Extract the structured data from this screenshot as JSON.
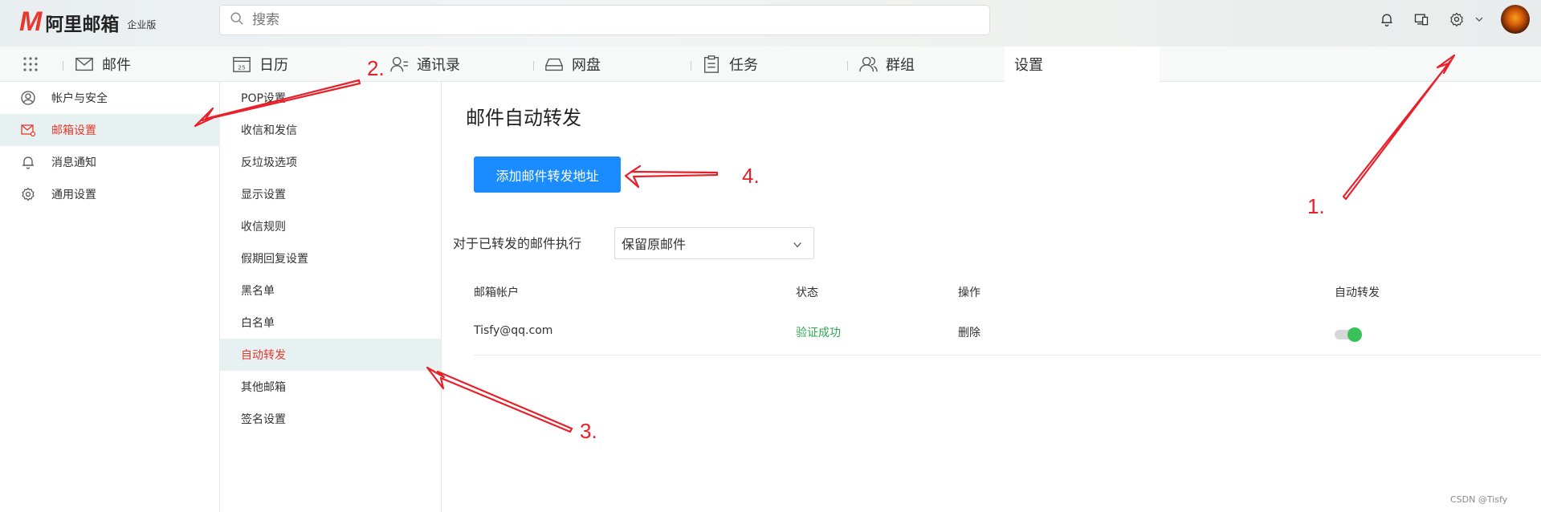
{
  "brand": {
    "mark": "M",
    "name": "阿里邮箱",
    "edition": "企业版",
    "accent": "#e8372c"
  },
  "search": {
    "placeholder": "搜索"
  },
  "header_icons": [
    "bell-icon",
    "devices-icon",
    "gear-icon",
    "chevron-down-icon"
  ],
  "nav": {
    "tabs": [
      {
        "label": "邮件",
        "icon": "mail-icon"
      },
      {
        "label": "日历",
        "icon": "calendar-icon",
        "badge": "25"
      },
      {
        "label": "通讯录",
        "icon": "contacts-icon"
      },
      {
        "label": "网盘",
        "icon": "drive-icon"
      },
      {
        "label": "任务",
        "icon": "clipboard-icon"
      },
      {
        "label": "群组",
        "icon": "group-icon"
      },
      {
        "label": "设置",
        "active": true
      }
    ]
  },
  "sidebar": {
    "items": [
      {
        "label": "帐户与安全",
        "icon": "user-icon"
      },
      {
        "label": "邮箱设置",
        "icon": "mail-settings-icon",
        "active": true
      },
      {
        "label": "消息通知",
        "icon": "bell-icon"
      },
      {
        "label": "通用设置",
        "icon": "gear-icon"
      }
    ]
  },
  "submenu": {
    "items": [
      {
        "label": "POP设置"
      },
      {
        "label": "收信和发信"
      },
      {
        "label": "反垃圾选项"
      },
      {
        "label": "显示设置"
      },
      {
        "label": "收信规则"
      },
      {
        "label": "假期回复设置"
      },
      {
        "label": "黑名单"
      },
      {
        "label": "白名单"
      },
      {
        "label": "自动转发",
        "active": true
      },
      {
        "label": "其他邮箱"
      },
      {
        "label": "签名设置"
      }
    ]
  },
  "main": {
    "title": "邮件自动转发",
    "add_button": "添加邮件转发地址",
    "exec_label": "对于已转发的邮件执行",
    "exec_value": "保留原邮件",
    "table": {
      "headers": [
        "邮箱帐户",
        "状态",
        "操作",
        "自动转发"
      ],
      "rows": [
        {
          "account": "Tisfy@qq.com",
          "status": "验证成功",
          "action": "删除",
          "auto_forward": true
        }
      ]
    }
  },
  "annotations": [
    "1.",
    "2.",
    "3.",
    "4."
  ],
  "watermark": "CSDN @Tisfy",
  "colors": {
    "primary_button": "#1a8cff",
    "success": "#2fa84f",
    "active_text": "#e8372c",
    "annotation": "#e8202a"
  }
}
